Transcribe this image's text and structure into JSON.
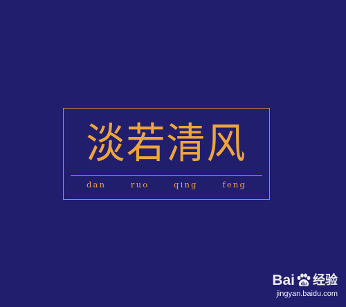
{
  "logo": {
    "title": "淡若清风",
    "pinyin": "dan  ruo  qing  feng"
  },
  "watermark": {
    "brand_prefix": "Bai",
    "brand_suffix": "经验",
    "url": "jingyan.baidu.com"
  },
  "colors": {
    "background": "#221e6e",
    "accent": "#f0a53a",
    "frame": "#c8873a",
    "watermark": "#ffffff"
  },
  "icons": {
    "watermark_logo": "baidu-paw-icon"
  }
}
